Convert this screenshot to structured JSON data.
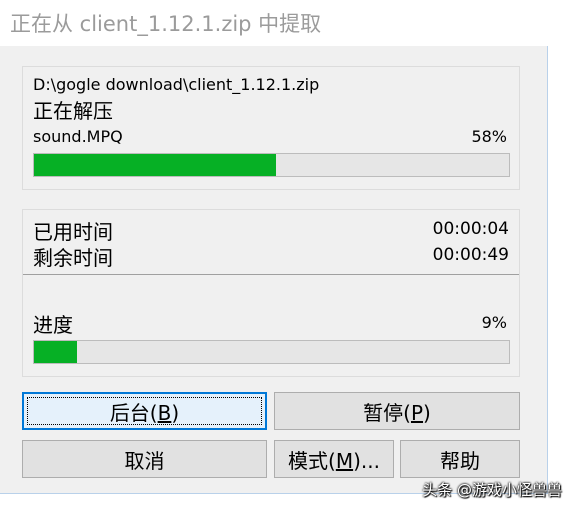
{
  "window": {
    "title": "正在从 client_1.12.1.zip 中提取"
  },
  "extract_group": {
    "archive_path": "D:\\gogle download\\client_1.12.1.zip",
    "status": "正在解压",
    "current_file": "sound.MPQ",
    "file_percent_label": "58%",
    "file_progress": 0.51
  },
  "time_group": {
    "elapsed_label": "已用时间",
    "elapsed_value": "00:00:04",
    "remaining_label": "剩余时间",
    "remaining_value": "00:00:49",
    "progress_label": "进度",
    "total_percent_label": "9%",
    "total_progress": 0.09
  },
  "buttons": {
    "background": {
      "text": "后台(",
      "mnemonic": "B",
      "tail": ")"
    },
    "pause": {
      "text": "暂停(",
      "mnemonic": "P",
      "tail": ")"
    },
    "cancel": {
      "text": "取消"
    },
    "mode": {
      "text": "模式(",
      "mnemonic": "M",
      "tail": ")..."
    },
    "help": {
      "text": "帮助"
    }
  },
  "watermark": {
    "text": "头条 @游戏小怪兽兽"
  },
  "colors": {
    "progress_fill": "#06b025",
    "focus_border": "#0078d7"
  }
}
